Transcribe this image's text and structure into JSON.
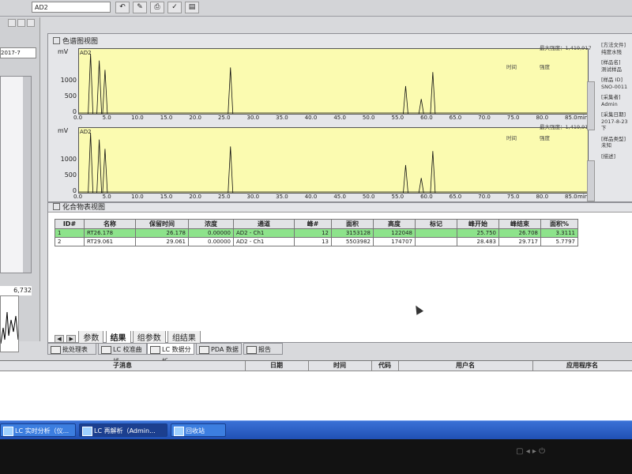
{
  "toolbar": {
    "field_value": "AD2"
  },
  "left": {
    "date_combo": "2017-7",
    "value_readout": "6,732"
  },
  "chrom_view": {
    "title": "色谱图视图",
    "plots": [
      {
        "channel": "AD2",
        "unit": "mV",
        "y_ticks": [
          "1000",
          "500",
          "0"
        ],
        "max_label": "最大强度：1,419,917",
        "time_label": "时间",
        "strength_label": "强度"
      },
      {
        "channel": "AD2",
        "unit": "mV",
        "y_ticks": [
          "1000",
          "500",
          "0"
        ],
        "max_label": "最大强度：1,419,917",
        "time_label": "时间",
        "strength_label": "强度"
      }
    ],
    "x_ticks": [
      "0.0",
      "5.0",
      "10.0",
      "15.0",
      "20.0",
      "25.0",
      "30.0",
      "35.0",
      "40.0",
      "45.0",
      "50.0",
      "55.0",
      "60.0",
      "65.0",
      "70.0",
      "75.0",
      "80.0",
      "85.0",
      "min"
    ],
    "side_info": [
      "[方法文件]",
      "纯度水残",
      "[样品名]",
      "测试样品",
      "[样品 ID]",
      "SNO-0011",
      "[采集者]",
      "Admin",
      "[采集日期]",
      "2017-8-23 下",
      "[样品类型]",
      "未知",
      "[描述]"
    ]
  },
  "compound_view": {
    "title": "化合物表视图",
    "headers": [
      "ID#",
      "名称",
      "保留时间",
      "浓度",
      "通道",
      "峰#",
      "面积",
      "高度",
      "标记",
      "峰开始",
      "峰结束",
      "面积%"
    ],
    "rows": [
      [
        "1",
        "RT26.178",
        "26.178",
        "0.00000",
        "AD2 - Ch1",
        "12",
        "3153128",
        "122048",
        "",
        "25.750",
        "26.708",
        "3.3111"
      ],
      [
        "2",
        "RT29.061",
        "29.061",
        "0.00000",
        "AD2 - Ch1",
        "13",
        "5503982",
        "174707",
        "",
        "28.483",
        "29.717",
        "5.7797"
      ]
    ],
    "tabs": [
      "参数",
      "结果",
      "组参数",
      "组结果"
    ]
  },
  "bottom_tabs": [
    "批处理表",
    "LC 校准曲线",
    "LC 数据分析",
    "PDA 数据",
    "报告"
  ],
  "log": {
    "headers": [
      "子消息",
      "日期",
      "时间",
      "代码",
      "用户名",
      "应用程序名"
    ]
  },
  "taskbar": {
    "tasks": [
      "LC 实时分析（仪...",
      "LC 再解析（Admin...",
      "回收站"
    ]
  },
  "chart_data": [
    {
      "type": "line",
      "series": [
        {
          "name": "AD2"
        }
      ],
      "ylabel": "mV",
      "xlabel": "min",
      "xlim": [
        0,
        88
      ],
      "ylim": [
        0,
        1400
      ],
      "peaks": [
        {
          "x": 2.0,
          "y": 1300
        },
        {
          "x": 3.5,
          "y": 1150
        },
        {
          "x": 4.5,
          "y": 950
        },
        {
          "x": 26.2,
          "y": 1000
        },
        {
          "x": 56.5,
          "y": 600
        },
        {
          "x": 59.2,
          "y": 320
        },
        {
          "x": 61.2,
          "y": 900
        }
      ]
    },
    {
      "type": "line",
      "series": [
        {
          "name": "AD2"
        }
      ],
      "ylabel": "mV",
      "xlabel": "min",
      "xlim": [
        0,
        88
      ],
      "ylim": [
        0,
        1400
      ],
      "peaks": [
        {
          "x": 2.0,
          "y": 1300
        },
        {
          "x": 3.5,
          "y": 1150
        },
        {
          "x": 4.5,
          "y": 950
        },
        {
          "x": 26.2,
          "y": 1000
        },
        {
          "x": 56.5,
          "y": 600
        },
        {
          "x": 59.2,
          "y": 320
        },
        {
          "x": 61.2,
          "y": 900
        }
      ]
    }
  ]
}
